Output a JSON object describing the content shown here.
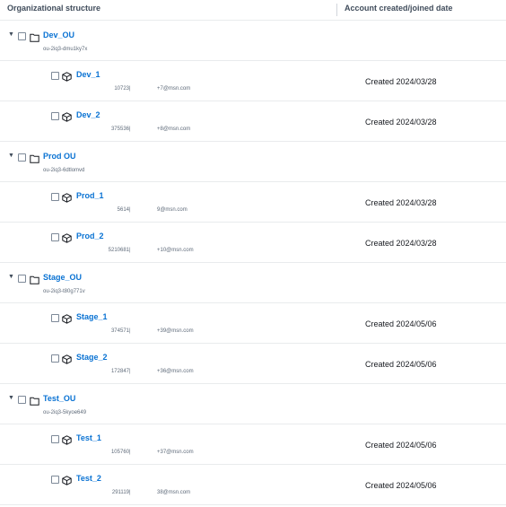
{
  "columns": {
    "structure": "Organizational structure",
    "created": "Account created/joined date"
  },
  "ous": [
    {
      "name": "Dev_OU",
      "id": "ou-2iq3-dmu1ky7x",
      "accounts": [
        {
          "name": "Dev_1",
          "id_partial": "10723",
          "email_partial": "+7@msn.com",
          "created": "Created 2024/03/28"
        },
        {
          "name": "Dev_2",
          "id_partial": "375536",
          "email_partial": "+8@msn.com",
          "created": "Created 2024/03/28"
        }
      ]
    },
    {
      "name": "Prod OU",
      "id": "ou-2iq3-6dtlomvd",
      "accounts": [
        {
          "name": "Prod_1",
          "id_partial": "5614",
          "email_partial": "9@msn.com",
          "created": "Created 2024/03/28"
        },
        {
          "name": "Prod_2",
          "id_partial": "5210681",
          "email_partial": "+10@msn.com",
          "created": "Created 2024/03/28"
        }
      ]
    },
    {
      "name": "Stage_OU",
      "id": "ou-2iq3-t80g771v",
      "accounts": [
        {
          "name": "Stage_1",
          "id_partial": "374571",
          "email_partial": "+39@msn.com",
          "created": "Created 2024/05/06"
        },
        {
          "name": "Stage_2",
          "id_partial": "172847",
          "email_partial": "+36@msn.com",
          "created": "Created 2024/05/06"
        }
      ]
    },
    {
      "name": "Test_OU",
      "id": "ou-2iq3-5kyoe649",
      "accounts": [
        {
          "name": "Test_1",
          "id_partial": "105760",
          "email_partial": "+37@msn.com",
          "created": "Created 2024/05/06"
        },
        {
          "name": "Test_2",
          "id_partial": "291119",
          "email_partial": "38@msn.com",
          "created": "Created 2024/05/06"
        }
      ]
    }
  ],
  "id_separator": "|",
  "icons": {
    "expand": "caret-down-icon",
    "ou": "folder-icon",
    "account": "cube-icon"
  },
  "colors": {
    "link": "#0972d3",
    "text": "#16191f",
    "muted": "#5f6b7a",
    "border": "#e9ebed"
  }
}
